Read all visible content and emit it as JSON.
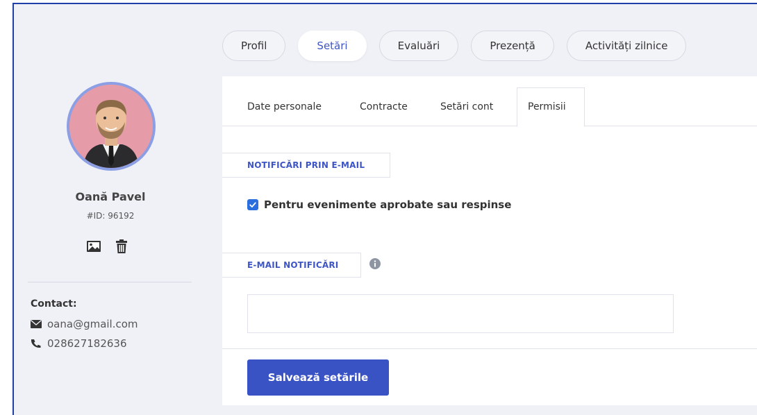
{
  "profile": {
    "name": "Oană Pavel",
    "id_label": "#ID: 96192",
    "contact_title": "Contact:",
    "email": "oana@gmail.com",
    "phone": "028627182636"
  },
  "main_tabs": [
    {
      "label": "Profil",
      "active": false
    },
    {
      "label": "Setări",
      "active": true
    },
    {
      "label": "Evaluări",
      "active": false
    },
    {
      "label": "Prezență",
      "active": false
    },
    {
      "label": "Activități zilnice",
      "active": false
    }
  ],
  "sub_tabs": [
    {
      "label": "Date personale",
      "active": false
    },
    {
      "label": "Contracte",
      "active": false
    },
    {
      "label": "Setări cont",
      "active": false
    },
    {
      "label": "Permisii",
      "active": true
    }
  ],
  "notifications": {
    "section_title": "NOTIFICĂRI PRIN E-MAIL",
    "checkbox_label": "Pentru evenimente aprobate sau respinse",
    "checkbox_checked": true
  },
  "email_notifications": {
    "section_title": "E-MAIL NOTIFICĂRI",
    "value": "",
    "placeholder": ""
  },
  "actions": {
    "save_label": "Salvează setările"
  },
  "colors": {
    "accent": "#3952c4",
    "link": "#3e55c6",
    "checkbox": "#2b6fde",
    "sidebar_bg": "#eff1f6"
  },
  "icons": {
    "avatar_upload": "image-icon",
    "avatar_delete": "trash-icon",
    "email": "envelope-icon",
    "phone": "phone-icon",
    "info": "info-circle-icon"
  }
}
